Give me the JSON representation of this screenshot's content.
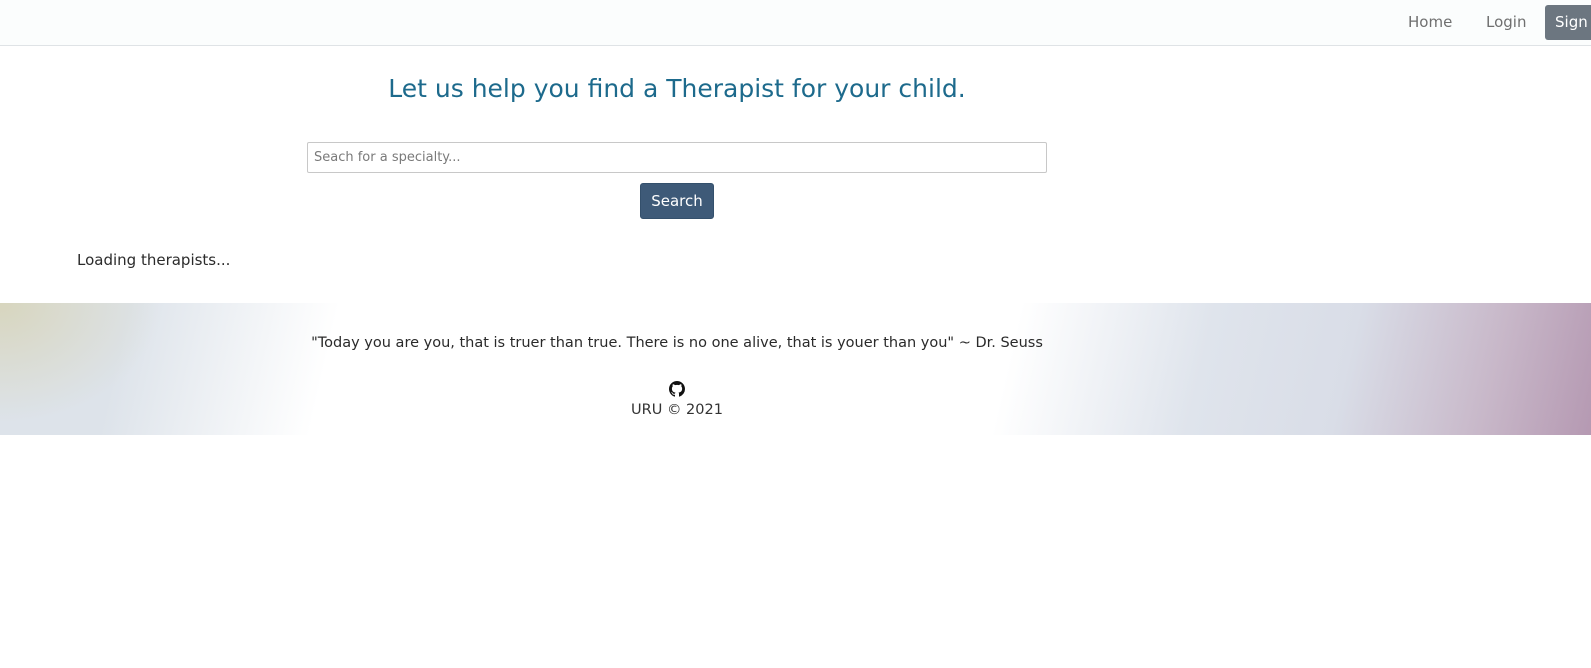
{
  "nav": {
    "home_label": "Home",
    "login_label": "Login",
    "signup_label": "Sign"
  },
  "main": {
    "title": "Let us help you find a Therapist for your child.",
    "search_placeholder": "Seach for a specialty...",
    "search_value": "",
    "search_button_label": "Search",
    "loading_text": "Loading therapists..."
  },
  "footer": {
    "quote": "\"Today you are you, that is truer than true. There is no one alive, that is youer than you\" ~ Dr. Seuss",
    "github_icon": "github-icon",
    "copyright": "URU © 2021"
  },
  "colors": {
    "title": "#1d6a8c",
    "search_button": "#3e5a78",
    "signup_button": "#6c7680",
    "footer_right_accent": "#b599b2"
  }
}
